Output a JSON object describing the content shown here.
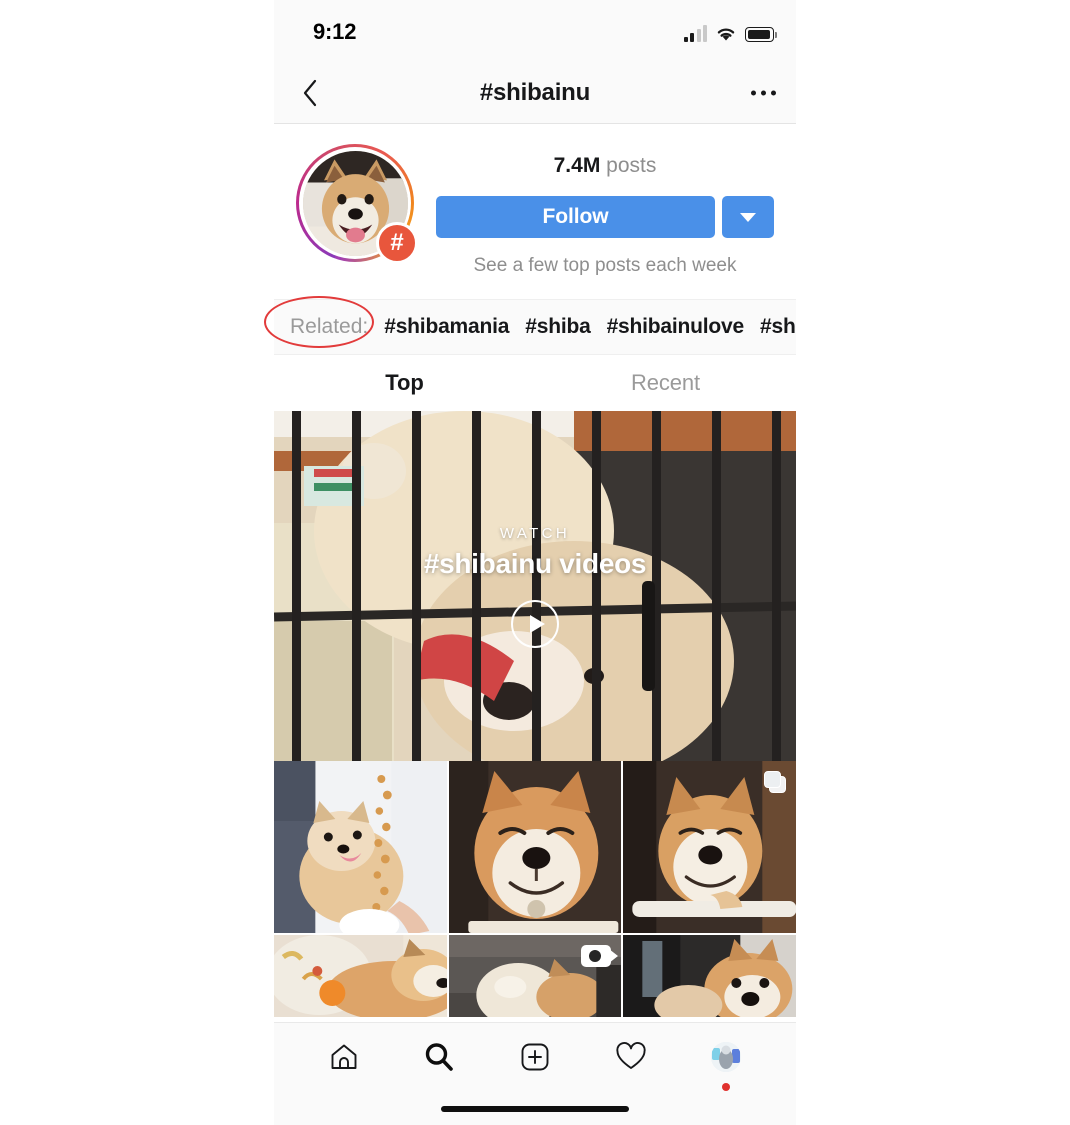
{
  "status_bar": {
    "time": "9:12",
    "cellular_icon": "cellular-signal-icon",
    "cellular_bars_filled": 2,
    "wifi_icon": "wifi-icon",
    "battery_icon": "battery-icon",
    "battery_level_pct": 92
  },
  "nav": {
    "back_icon": "chevron-left-icon",
    "title": "#shibainu",
    "more_icon": "more-options-icon"
  },
  "profile": {
    "avatar_icon": "hashtag-avatar",
    "badge_glyph": "#",
    "posts_count": "7.4M",
    "posts_label": "posts",
    "follow_label": "Follow",
    "follow_dropdown_icon": "chevron-down-icon",
    "subtitle": "See a few top posts each week"
  },
  "related": {
    "label": "Related:",
    "tags": [
      "#shibamania",
      "#shiba",
      "#shibainulove",
      "#shiba"
    ]
  },
  "annotation": {
    "shape": "ellipse",
    "target": "Related:",
    "color": "#e23b3b"
  },
  "tabs": [
    {
      "label": "Top",
      "active": true
    },
    {
      "label": "Recent",
      "active": false
    }
  ],
  "hero": {
    "eyebrow": "WATCH",
    "title": "#shibainu videos",
    "play_icon": "play-icon"
  },
  "grid": {
    "rows": [
      [
        {
          "alt": "shiba licking treats",
          "badge": null
        },
        {
          "alt": "smiling shiba close-up",
          "badge": null
        },
        {
          "alt": "smiling shiba on rail",
          "badge": "carousel-icon"
        }
      ],
      [
        {
          "alt": "shiba lying with orange",
          "badge": null
        },
        {
          "alt": "shiba with round lamp",
          "badge": "video-icon"
        },
        {
          "alt": "shiba on floor",
          "badge": null
        }
      ]
    ]
  },
  "tabbar": {
    "items": [
      {
        "icon": "home-icon",
        "active": false
      },
      {
        "icon": "search-icon",
        "active": true
      },
      {
        "icon": "add-post-icon",
        "active": false
      },
      {
        "icon": "activity-heart-icon",
        "active": false
      },
      {
        "icon": "profile-avatar-icon",
        "active": false,
        "notification": true
      }
    ],
    "home_indicator": "home-indicator"
  },
  "colors": {
    "accent_blue": "#4a90e8",
    "hashtag_badge": "#e8563c",
    "annotation_red": "#e23b3b",
    "text_primary": "#17181a",
    "text_secondary": "#8e8e8e",
    "header_bg": "#fafafa"
  }
}
